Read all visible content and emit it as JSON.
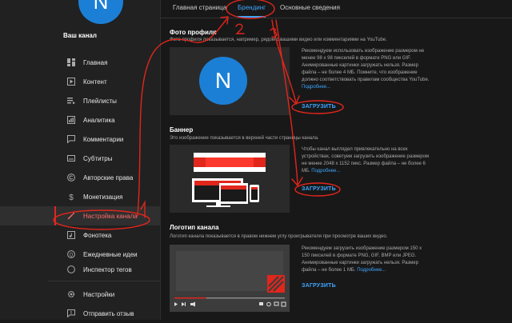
{
  "channel": {
    "avatar_letter": "N",
    "label": "Ваш канал"
  },
  "nav": [
    {
      "label": "Главная",
      "icon": "dashboard-icon"
    },
    {
      "label": "Контент",
      "icon": "video-icon"
    },
    {
      "label": "Плейлисты",
      "icon": "playlist-icon"
    },
    {
      "label": "Аналитика",
      "icon": "analytics-icon"
    },
    {
      "label": "Комментарии",
      "icon": "comments-icon"
    },
    {
      "label": "Субтитры",
      "icon": "subtitles-icon"
    },
    {
      "label": "Авторские права",
      "icon": "copyright-icon"
    },
    {
      "label": "Монетизация",
      "icon": "dollar-icon"
    },
    {
      "label": "Настройка канала",
      "icon": "magic-wand-icon",
      "active": true
    },
    {
      "label": "Фонотека",
      "icon": "audio-library-icon"
    },
    {
      "label": "Ежедневные идеи",
      "icon": "ideas-icon"
    },
    {
      "label": "Инспектор тегов",
      "icon": "tags-icon"
    }
  ],
  "nav_bottom": [
    {
      "label": "Настройки",
      "icon": "gear-icon"
    },
    {
      "label": "Отправить отзыв",
      "icon": "feedback-icon"
    }
  ],
  "tabs": [
    {
      "label": "Главная страница"
    },
    {
      "label": "Брендинг",
      "active": true
    },
    {
      "label": "Основные сведения"
    }
  ],
  "profile_photo": {
    "title": "Фото профиля",
    "desc": "Фото профиля показывается, например, рядом с вашими видео или комментариями на YouTube.",
    "avatar_letter": "N",
    "info": "Рекомендуем использовать изображение размером не менее 98 х 98 пикселей в формате PNG или GIF. Анимированные картинки загружать нельзя. Размер файла – не более 4 МБ. Помните, что изображение должно соответствовать правилам сообщества YouTube.",
    "more": "Подробнее...",
    "upload": "ЗАГРУЗИТЬ"
  },
  "banner": {
    "title": "Баннер",
    "desc": "Это изображение показывается в верхней части страницы канала.",
    "info": "Чтобы канал выглядел привлекательно на всех устройствах, советуем загрузить изображение размером не менее 2048 х 1152 пикс. Размер файла – не более 6 МБ.",
    "more": "Подробнее...",
    "upload": "ЗАГРУЗИТЬ"
  },
  "watermark": {
    "title": "Логотип канала",
    "desc": "Логотип канала показывается в правом нижнем углу проигрывателя при просмотре ваших видео.",
    "info": "Рекомендуем загрузить изображение размером 150 х 150 пикселей в формате PNG, GIF, BMP или JPEG. Анимированные картинки загружать нельзя. Размер файла – не более 1 МБ.",
    "more": "Подробнее...",
    "upload": "ЗАГРУЗИТЬ"
  },
  "annotations": {
    "one": "1",
    "two": "2"
  },
  "colors": {
    "accent": "#3ea6ff",
    "annotation": "#e1261c",
    "avatar": "#1c7fd6",
    "background": "#181818"
  }
}
